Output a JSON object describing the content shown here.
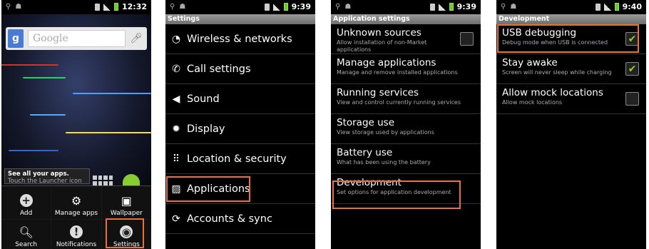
{
  "home": {
    "time": "12:32",
    "search_placeholder": "Google",
    "hint_title": "See all your apps.",
    "hint_sub": "Touch the Launcher icon",
    "menu": [
      {
        "label": "Add",
        "icon": "plus-icon"
      },
      {
        "label": "Manage apps",
        "icon": "manage-apps-icon"
      },
      {
        "label": "Wallpaper",
        "icon": "wallpaper-icon"
      },
      {
        "label": "Search",
        "icon": "search-icon"
      },
      {
        "label": "Notifications",
        "icon": "notifications-icon"
      },
      {
        "label": "Settings",
        "icon": "settings-icon"
      }
    ]
  },
  "settings": {
    "time": "9:39",
    "title": "Settings",
    "items": [
      {
        "label": "Wireless & networks",
        "icon": "wifi-icon"
      },
      {
        "label": "Call settings",
        "icon": "phone-icon"
      },
      {
        "label": "Sound",
        "icon": "speaker-icon"
      },
      {
        "label": "Display",
        "icon": "display-icon"
      },
      {
        "label": "Location & security",
        "icon": "location-grid-icon"
      },
      {
        "label": "Applications",
        "icon": "applications-icon"
      },
      {
        "label": "Accounts & sync",
        "icon": "sync-icon"
      }
    ]
  },
  "app_settings": {
    "time": "9:39",
    "title": "Application settings",
    "items": [
      {
        "title": "Unknown sources",
        "subtitle": "Allow installation of non-Market applications",
        "checkbox": true,
        "checked": false
      },
      {
        "title": "Manage applications",
        "subtitle": "Manage and remove installed applications"
      },
      {
        "title": "Running services",
        "subtitle": "View and control currently running services"
      },
      {
        "title": "Storage use",
        "subtitle": "View storage used by applications"
      },
      {
        "title": "Battery use",
        "subtitle": "What has been using the battery"
      },
      {
        "title": "Development",
        "subtitle": "Set options for application development"
      }
    ]
  },
  "development": {
    "time": "9:40",
    "title": "Development",
    "items": [
      {
        "title": "USB debugging",
        "subtitle": "Debug mode when USB is connected",
        "checked": true
      },
      {
        "title": "Stay awake",
        "subtitle": "Screen will never sleep while charging",
        "checked": true
      },
      {
        "title": "Allow mock locations",
        "subtitle": "Allow mock locations",
        "checked": false
      }
    ]
  },
  "colors": {
    "highlight": "#e8703a",
    "check": "#99cc22"
  }
}
